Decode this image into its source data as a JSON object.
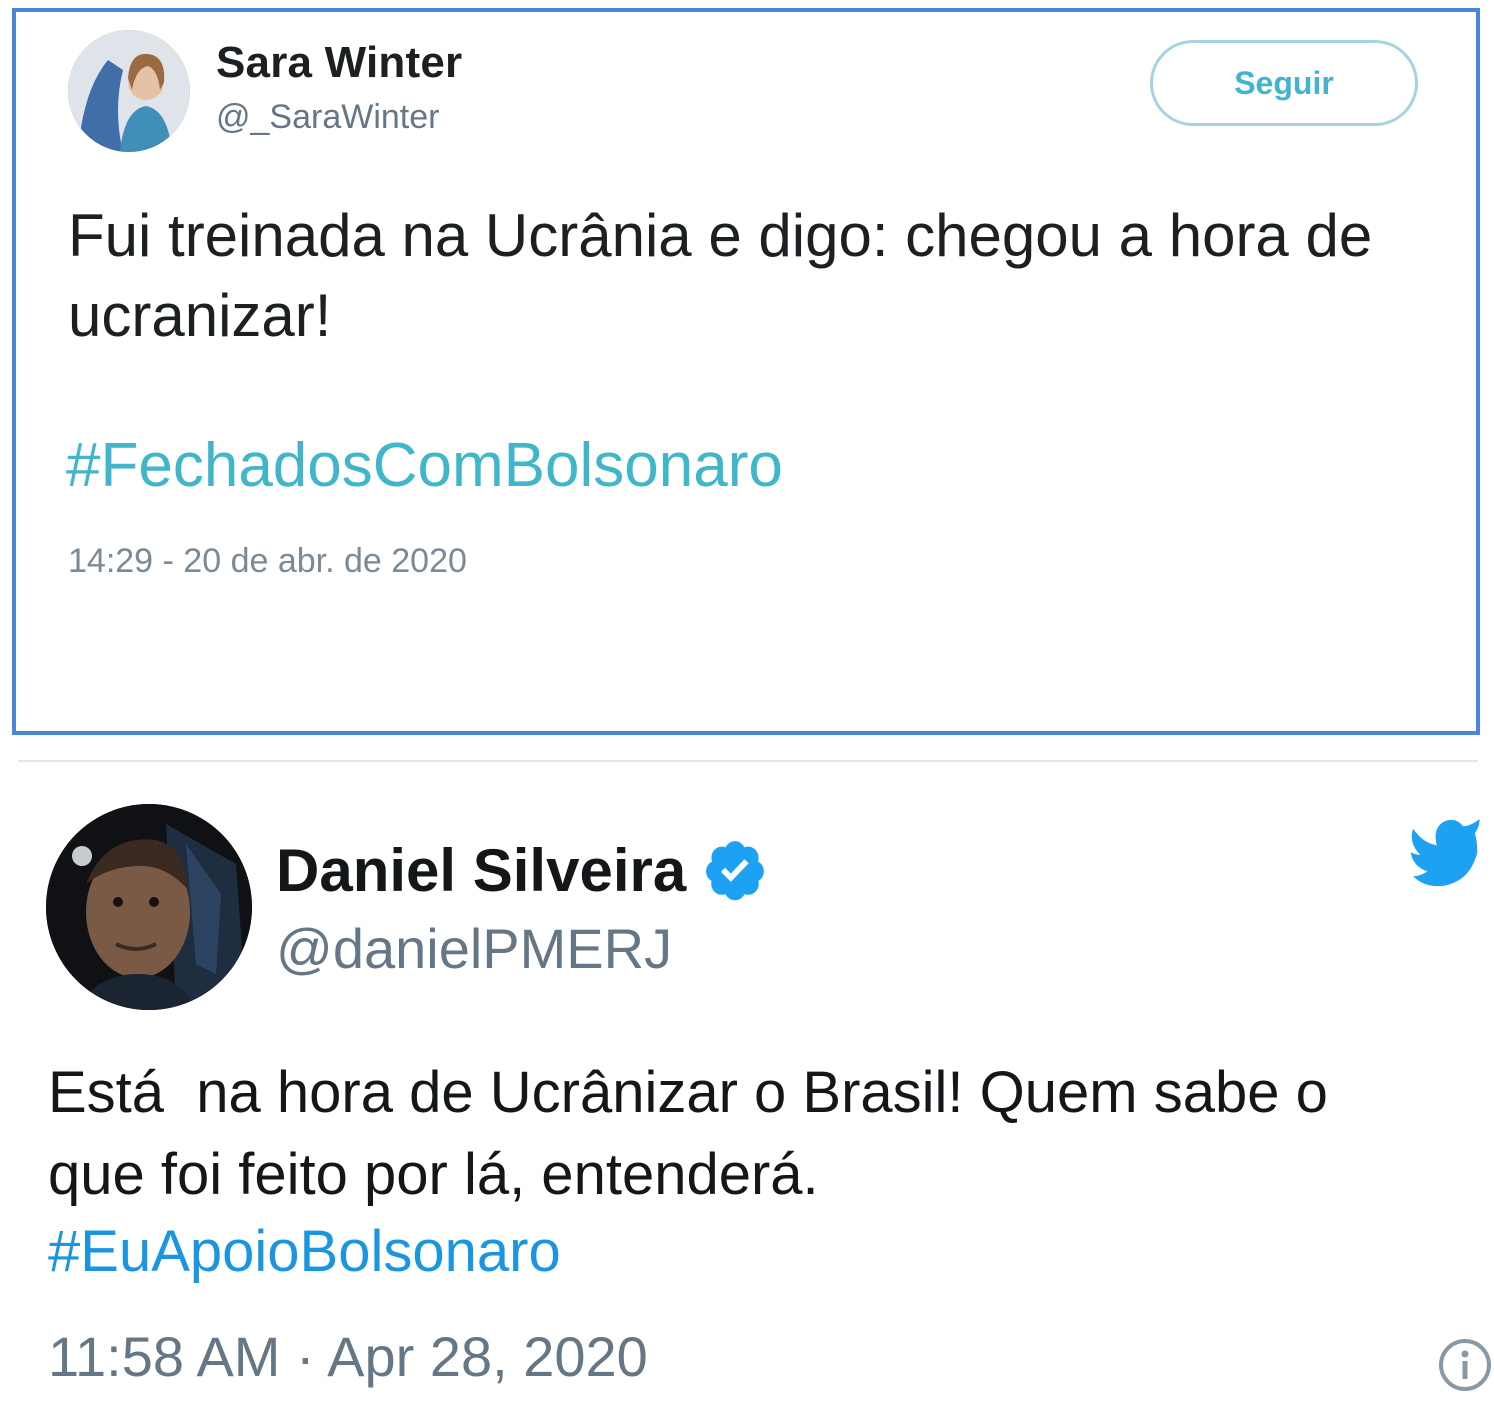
{
  "tweet1": {
    "author_name": "Sara Winter",
    "author_handle": "@_SaraWinter",
    "follow_label": "Seguir",
    "text": "Fui treinada na Ucrânia e digo: chegou a hora de ucranizar!",
    "hashtag": "#FechadosComBolsonaro",
    "timestamp": "14:29 - 20 de abr. de 2020"
  },
  "tweet2": {
    "author_name": "Daniel Silveira",
    "author_handle": "@danielPMERJ",
    "verified": true,
    "text_line1": "Está  na hora de Ucrânizar o Brasil! Quem sabe o",
    "text_line2": "que foi feito por lá, entenderá.",
    "hashtag": "#EuApoioBolsonaro",
    "timestamp": "11:58 AM · Apr 28, 2020"
  },
  "colors": {
    "frame_border": "#4a86d6",
    "hashtag1": "#3fb6c9",
    "hashtag2": "#1b95e0",
    "verified_badge": "#1da1f2",
    "twitter_bird": "#1da1f2"
  },
  "icons": {
    "verified": "verified-badge-icon",
    "bird": "twitter-bird-icon",
    "info": "info-icon"
  }
}
